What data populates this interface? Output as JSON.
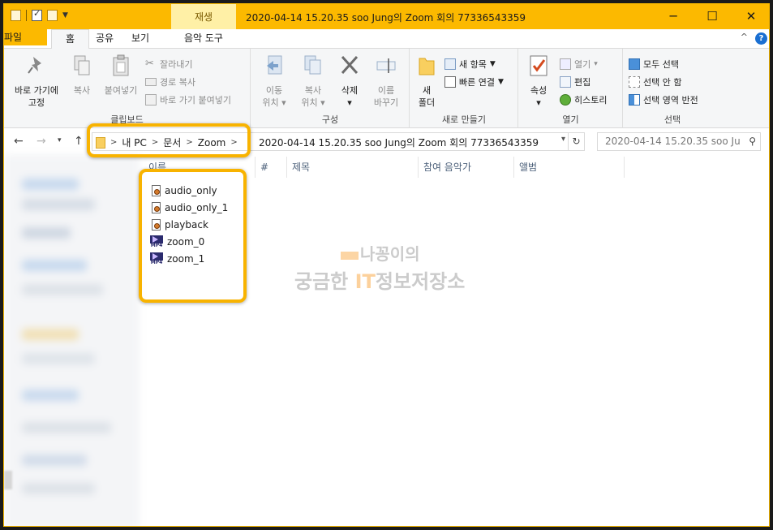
{
  "titlebar": {
    "contextual_tab": "재생",
    "title": "2020-04-14 15.20.35 soo Jung의 Zoom 회의 77336543359",
    "minimize": "─",
    "maximize": "☐",
    "close": "✕"
  },
  "tabs": {
    "file": "파일",
    "home": "홈",
    "share": "공유",
    "view": "보기",
    "music_tools": "음악 도구"
  },
  "ribbon": {
    "clipboard": {
      "label": "클립보드",
      "pin": "바로 가기에",
      "pin2": "고정",
      "copy": "복사",
      "paste": "붙여넣기",
      "cut": "잘라내기",
      "copy_path": "경로 복사",
      "paste_shortcut": "바로 가기 붙여넣기"
    },
    "organize": {
      "label": "구성",
      "move_to": "이동",
      "move_to2": "위치",
      "copy_to": "복사",
      "copy_to2": "위치",
      "delete": "삭제",
      "rename": "이름",
      "rename2": "바꾸기"
    },
    "new": {
      "label": "새로 만들기",
      "new_folder": "새",
      "new_folder2": "폴더",
      "new_item": "새 항목",
      "easy_access": "빠른 연결"
    },
    "open": {
      "label": "열기",
      "properties": "속성",
      "open": "열기",
      "edit": "편집",
      "history": "히스토리"
    },
    "select": {
      "label": "선택",
      "select_all": "모두 선택",
      "select_none": "선택 안 함",
      "invert": "선택 영역 반전"
    }
  },
  "address": {
    "crumbs": [
      "내 PC",
      "문서",
      "Zoom"
    ],
    "current": "2020-04-14 15.20.35 soo Jung의 Zoom 회의 77336543359",
    "search_placeholder": "2020-04-14 15.20.35 soo Ju..."
  },
  "columns": [
    "이름",
    "#",
    "제목",
    "참여 음악가",
    "앨범"
  ],
  "files": [
    {
      "name": "audio_only",
      "icon": "audio-file-icon"
    },
    {
      "name": "audio_only_1",
      "icon": "audio-file-icon"
    },
    {
      "name": "playback",
      "icon": "audio-file-icon"
    },
    {
      "name": "zoom_0",
      "icon": "mp4-file-icon"
    },
    {
      "name": "zoom_1",
      "icon": "mp4-file-icon"
    }
  ],
  "mp4_label": "MP4",
  "watermark": {
    "line1": "나꽁이의",
    "line2a": "궁금한 ",
    "line2b": "IT",
    "line2c": "정보저장소"
  },
  "colors": {
    "accent": "#fcb900",
    "highlight": "#f8b300",
    "help": "#1a6fd2"
  }
}
